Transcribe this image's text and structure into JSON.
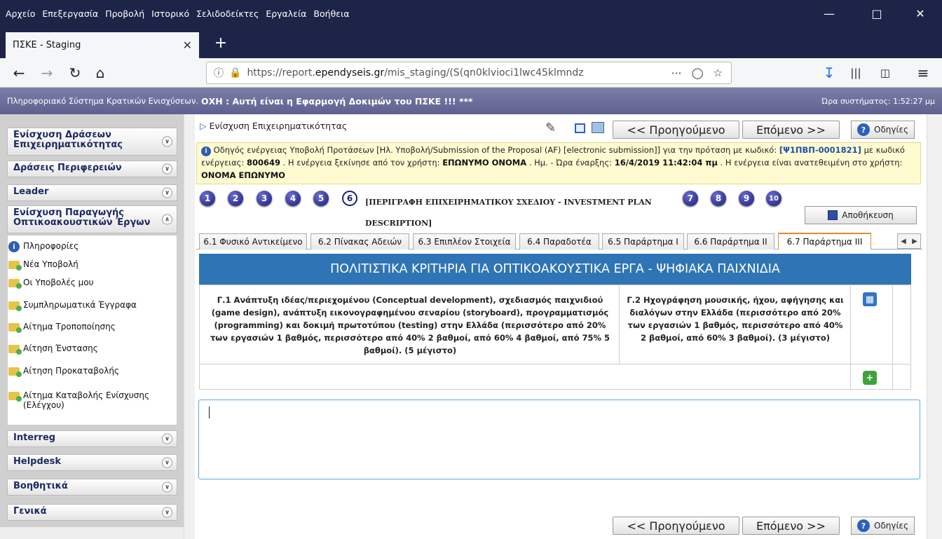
{
  "browser": {
    "menu": [
      "Αρχείο",
      "Επεξεργασία",
      "Προβολή",
      "Ιστορικό",
      "Σελιδοδείκτες",
      "Εργαλεία",
      "Βοήθεια"
    ],
    "tab_title": "ΠΣΚΕ - Staging",
    "url_prefix": "https://report.",
    "url_domain": "ependyseis.gr",
    "url_path": "/mis_staging/(S(qn0klvioci1lwc45klmndz"
  },
  "app_header": {
    "prefix": "Πληροφοριακό Σύστημα Κρατικών Ενισχύσεων.",
    "warning": "ΟΧΗ : Αυτή είναι η Εφαρμογή Δοκιμών του ΠΣΚΕ !!! ***",
    "system_time": "Ώρα συστήματος: 1:52:27 μμ"
  },
  "sidebar": {
    "sections_top": [
      {
        "label": "Ενίσχυση Δράσεων Επιχειρηματικότητας"
      },
      {
        "label": "Δράσεις Περιφερειών"
      },
      {
        "label": "Leader"
      },
      {
        "label": "Ενίσχυση Παραγωγής Οπτικοακουστικών Έργων"
      }
    ],
    "items": [
      "Πληροφορίες",
      "Νέα Υποβολή",
      "Οι Υποβολές μου",
      "Συμπληρωματικά Έγγραφα",
      "Αίτημα Τροποποίησης",
      "Αίτηση Ένστασης",
      "Αίτηση Προκαταβολής",
      "Αίτημα Καταβολής Ενίσχυσης (Ελέγχου)"
    ],
    "sections_bottom": [
      {
        "label": "Interreg"
      },
      {
        "label": "Helpdesk"
      },
      {
        "label": "Βοηθητικά"
      },
      {
        "label": "Γενικά"
      }
    ]
  },
  "main": {
    "breadcrumb": "Ενίσχυση Επιχειρηματικότητας",
    "prev_label": "<< Προηγούμενο",
    "next_label": "Επόμενο >>",
    "help_label": "Οδηγίες",
    "info": {
      "t1": "Οδηγός ενέργειας Υποβολή Προτάσεων [Ηλ. Υποβολή/Submission of the Proposal (AF) [electronic submission]] για την πρόταση με κωδικό:",
      "proposal_code": "[Ψ1ΠΒΠ-0001821]",
      "t2": "με κωδικό ενέργειας:",
      "action_code": "800649",
      "t3": ". Η ενέργεια ξεκίνησε από τον χρήστη:",
      "started_by": "ΕΠΩΝΥΜΟ ΟΝΟΜΑ",
      "t4": ". Ημ. - Ώρα έναρξης:",
      "start_time": "16/4/2019 11:42:04 πμ",
      "t5": ". Η ενέργεια είναι ανατεθειμένη στο χρήστη:",
      "assigned_to": "ΟΝΟΜΑ ΕΠΩΝΥΜΟ"
    },
    "steps": [
      "1",
      "2",
      "3",
      "4",
      "5",
      "6",
      "7",
      "8",
      "9",
      "10"
    ],
    "current_step_title": "[ΠΕΡΙΓΡΑΦΗ ΕΠΙΧΕΙΡΗΜΑΤΙΚΟΥ ΣΧΕΔΙΟΥ - INVESTMENT PLAN DESCRIPTION]",
    "save_label": "Αποθήκευση",
    "tabs": [
      "6.1 Φυσικό Αντικείμενο",
      "6.2 Πίνακας Αδειών",
      "6.3 Επιπλέον Στοιχεία",
      "6.4 Παραδοτέα",
      "6.5 Παράρτημα Ι",
      "6.6 Παράρτημα ΙΙ",
      "6.7 Παράρτημα ΙΙΙ"
    ],
    "table_title": "ΠΟΛΙΤΙΣΤΙΚΑ ΚΡΙΤΗΡΙΑ ΓΙΑ ΟΠΤΙΚΟΑΚΟΥΣΤΙΚΑ ΕΡΓΑ - ΨΗΦΙΑΚΑ ΠΑΙΧΝΙΔΙΑ",
    "col1": "Γ.1 Ανάπτυξη ιδέας/περιεχομένου (Conceptual development), σχεδιασμός παιχνιδιού (game design), ανάπτυξη εικονογραφημένου σεναρίου (storyboard), προγραμματισμός (programming) και δοκιμή πρωτοτύπου (testing) στην Ελλάδα (περισσότερο από 20% των εργασιών 1 βαθμός, περισσότερο από 40% 2 βαθμοί, από 60% 4 βαθμοί, από 75% 5 βαθμοί). (5 μέγιστο)",
    "col2": "Γ.2 Ηχογράφηση μουσικής, ήχου, αφήγησης και διαλόγων στην Ελλάδα (περισσότερο από 20% των εργασιών 1 βαθμός, περισσότερο από 40% 2 βαθμοί, από 60% 3 βαθμοί). (3 μέγιστο)",
    "textarea_value": ""
  }
}
